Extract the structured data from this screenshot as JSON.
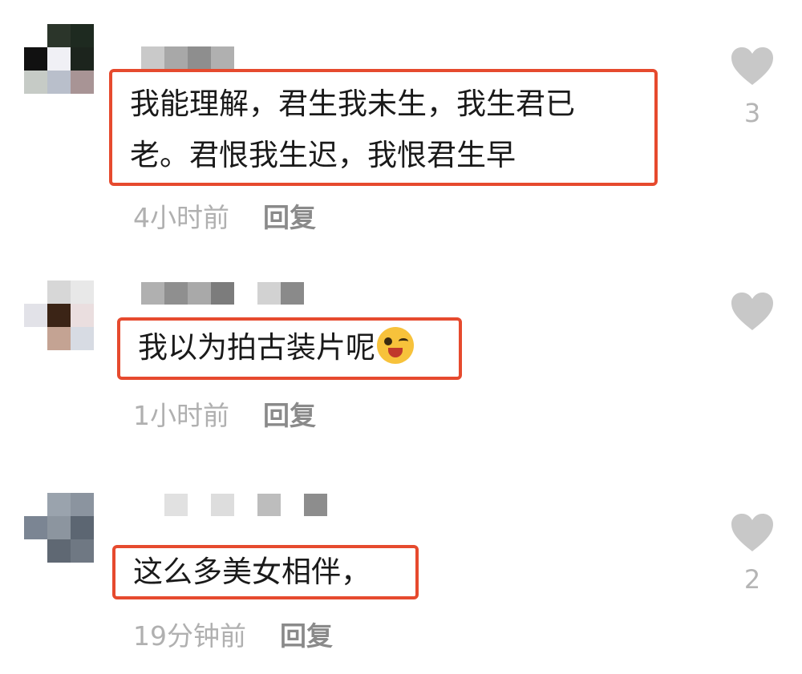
{
  "comments": [
    {
      "text_lines": [
        "我能理解，君生我未生，我生君已",
        "老。君恨我生迟，我恨君生早"
      ],
      "time": "4小时前",
      "reply_label": "回复",
      "likes": "3",
      "avatar_colors": [
        "#ffffff",
        "#2b352a",
        "#1e2a20",
        "#111111",
        "#f0f0f5",
        "#1c241d",
        "#c6cbc6",
        "#b9bfcb",
        "#a89495"
      ],
      "username_colors": [
        "#c9c9c9",
        "#a8a8a8",
        "#8e8e8e",
        "#b0b0b0"
      ]
    },
    {
      "text_lines": [
        "我以为拍古装片呢"
      ],
      "emoji": "winking-tongue-emoji",
      "time": "1小时前",
      "reply_label": "回复",
      "likes": "",
      "avatar_colors": [
        "#ffffff",
        "#d7d7d7",
        "#e8e8e8",
        "#e2e2e8",
        "#3b2416",
        "#eadedf",
        "#ffffff",
        "#c4a393",
        "#d7dbe3"
      ],
      "username_colors": [
        "#b0b0b0",
        "#8f8f8f",
        "#a9a9a9",
        "#7c7c7c",
        "#ffffff",
        "#d2d2d2",
        "#8a8a8a"
      ]
    },
    {
      "text_lines": [
        "这么多美女相伴，"
      ],
      "time": "19分钟前",
      "reply_label": "回复",
      "likes": "2",
      "avatar_colors": [
        "#ffffff",
        "#9aa3ad",
        "#8b949f",
        "#7b8593",
        "#8c959f",
        "#5c6672",
        "#ffffff",
        "#5f6873",
        "#6f7883"
      ],
      "username_colors": [
        "#ffffff",
        "#e1e1e1",
        "#ffffff",
        "#dddddd",
        "#ffffff",
        "#bdbdbd",
        "#ffffff",
        "#8d8d8d"
      ]
    }
  ],
  "colors": {
    "highlight_border": "#e64a2e",
    "heart": "#c8c8c8",
    "meta_text": "#b0b0b0",
    "reply_text": "#8a8a8a"
  }
}
